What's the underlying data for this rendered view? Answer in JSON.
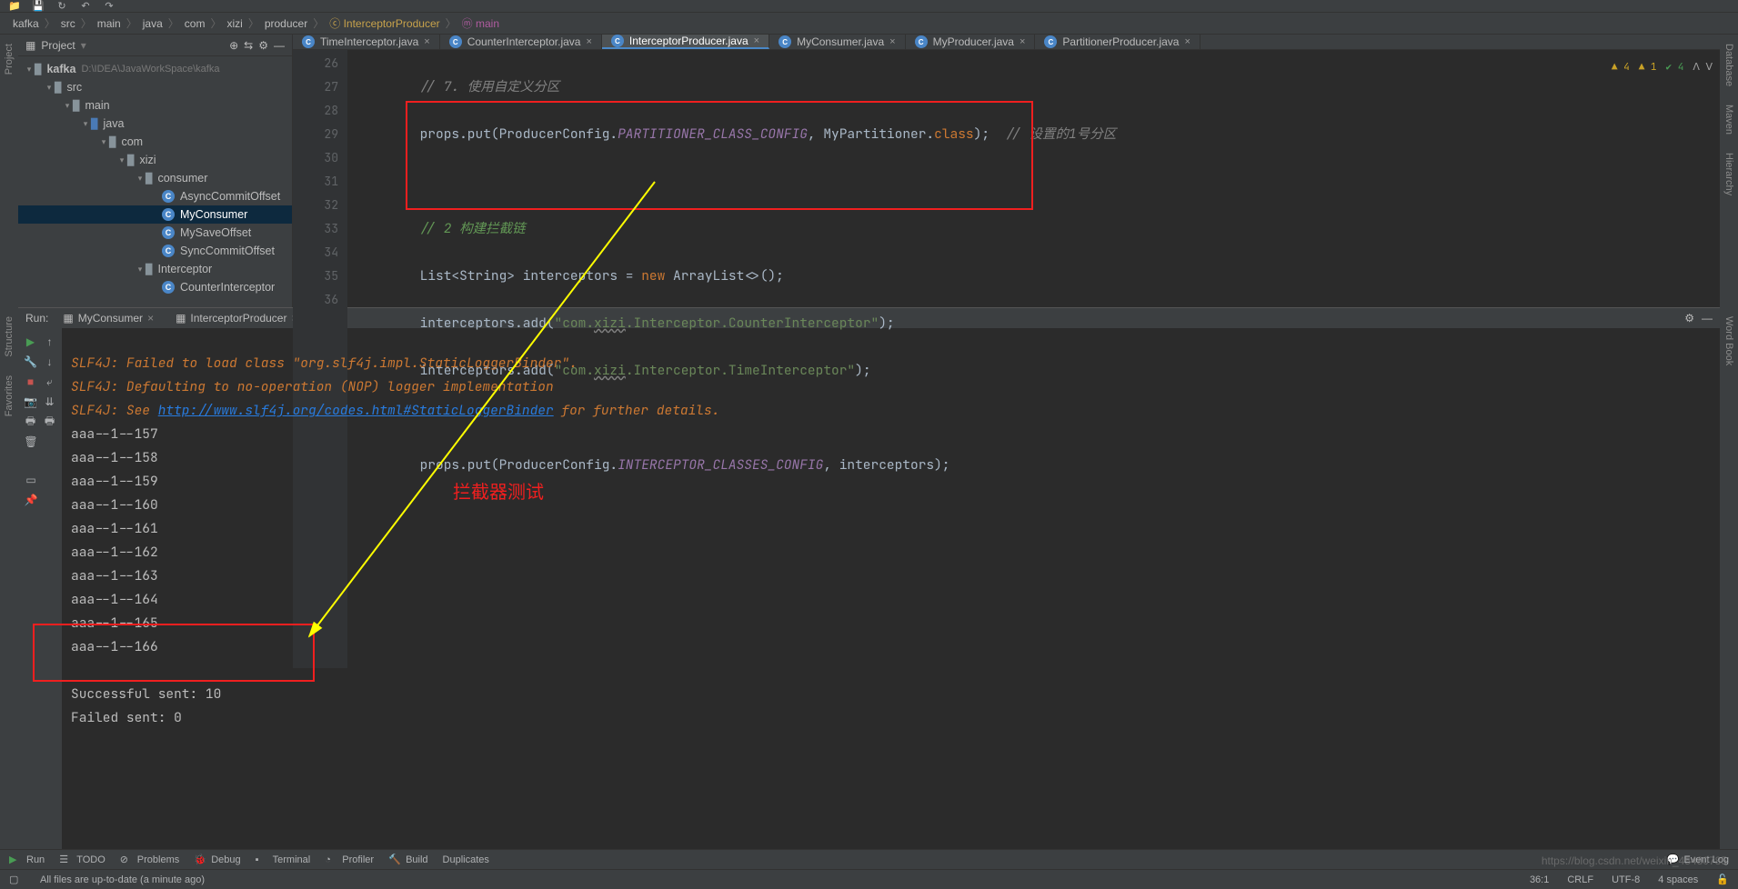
{
  "breadcrumb": [
    "kafka",
    "src",
    "main",
    "java",
    "com",
    "xizi",
    "producer",
    "InterceptorProducer",
    "main"
  ],
  "project": {
    "title": "Project",
    "root": {
      "label": "kafka",
      "hint": "D:\\IDEA\\JavaWorkSpace\\kafka"
    },
    "tree": [
      {
        "indent": 1,
        "arrow": "▾",
        "kind": "folder",
        "label": "src"
      },
      {
        "indent": 2,
        "arrow": "▾",
        "kind": "folder",
        "label": "main"
      },
      {
        "indent": 3,
        "arrow": "▾",
        "kind": "folder",
        "label": "java"
      },
      {
        "indent": 4,
        "arrow": "▾",
        "kind": "folder",
        "label": "com"
      },
      {
        "indent": 5,
        "arrow": "▾",
        "kind": "pkg",
        "label": "xizi"
      },
      {
        "indent": 6,
        "arrow": "▾",
        "kind": "pkg",
        "label": "consumer"
      },
      {
        "indent": 7,
        "arrow": "",
        "kind": "class",
        "label": "AsyncCommitOffset"
      },
      {
        "indent": 7,
        "arrow": "",
        "kind": "class",
        "label": "MyConsumer",
        "selected": true
      },
      {
        "indent": 7,
        "arrow": "",
        "kind": "class",
        "label": "MySaveOffset"
      },
      {
        "indent": 7,
        "arrow": "",
        "kind": "class",
        "label": "SyncCommitOffset"
      },
      {
        "indent": 6,
        "arrow": "▾",
        "kind": "pkg",
        "label": "Interceptor"
      },
      {
        "indent": 7,
        "arrow": "",
        "kind": "class",
        "label": "CounterInterceptor"
      }
    ]
  },
  "tabs": [
    {
      "label": "TimeInterceptor.java",
      "active": false
    },
    {
      "label": "CounterInterceptor.java",
      "active": false
    },
    {
      "label": "InterceptorProducer.java",
      "active": true
    },
    {
      "label": "MyConsumer.java",
      "active": false
    },
    {
      "label": "MyProducer.java",
      "active": false
    },
    {
      "label": "PartitionerProducer.java",
      "active": false
    }
  ],
  "inspection": {
    "warn1": "4",
    "warn2": "1",
    "ok": "4"
  },
  "code": {
    "line_numbers": [
      "26",
      "27",
      "28",
      "29",
      "30",
      "31",
      "32",
      "33",
      "34",
      "35",
      "36"
    ],
    "l27_a": "props.put(ProducerConfig.",
    "l27_b": "PARTITIONER_CLASS_CONFIG",
    "l27_c": ", MyPartitioner.",
    "l27_d": "class",
    "l27_e": ");  ",
    "l27_f": "// 设置的1号分区",
    "l29": "// 2 构建拦截链",
    "l30_a": "List<String> interceptors = ",
    "l30_b": "new",
    "l30_c": " ArrayList<>();",
    "l31_a": "interceptors.add(",
    "l31_b": "\"com.",
    "l31_c": "xizi",
    "l31_d": ".Interceptor.CounterInterceptor\"",
    "l31_e": ");",
    "l32_a": "interceptors.add(",
    "l32_b": "\"com.",
    "l32_c": "xizi",
    "l32_d": ".Interceptor.TimeInterceptor\"",
    "l32_e": ");",
    "l34_a": "props.put(ProducerConfig.",
    "l34_b": "INTERCEPTOR_CLASSES_CONFIG",
    "l34_c": ", interceptors);"
  },
  "run": {
    "label": "Run:",
    "tabs": [
      {
        "label": "MyConsumer"
      },
      {
        "label": "InterceptorProducer"
      }
    ],
    "lines": {
      "slf1": "SLF4J: Failed to load class \"org.slf4j.impl.StaticLoggerBinder\".",
      "slf2": "SLF4J: Defaulting to no-operation (NOP) logger implementation",
      "slf3a": "SLF4J: See ",
      "slf3b": "http://www.slf4j.org/codes.html#StaticLoggerBinder",
      "slf3c": " for further details.",
      "aaa": [
        "aaa--1--157",
        "aaa--1--158",
        "aaa--1--159",
        "aaa--1--160",
        "aaa--1--161",
        "aaa--1--162",
        "aaa--1--163",
        "aaa--1--164",
        "aaa--1--165",
        "aaa--1--166"
      ],
      "succ": "Successful sent: 10",
      "fail": "Failed sent: 0"
    }
  },
  "annotation": {
    "text": "拦截器测试"
  },
  "bottom_tools": {
    "run": "Run",
    "todo": "TODO",
    "problems": "Problems",
    "debug": "Debug",
    "terminal": "Terminal",
    "profiler": "Profiler",
    "build": "Build",
    "duplicates": "Duplicates",
    "eventlog": "Event Log"
  },
  "status": {
    "msg": "All files are up-to-date (a minute ago)",
    "pos": "36:1",
    "eol": "CRLF",
    "enc": "UTF-8",
    "indent": "4 spaces"
  },
  "sidestrip": {
    "left_items": [
      "Project",
      "Structure",
      "Favorites"
    ],
    "right_items": [
      "Database",
      "Maven",
      "Hierarchy",
      "Word Book"
    ]
  },
  "watermark": "https://blog.csdn.net/weixin_45480785"
}
